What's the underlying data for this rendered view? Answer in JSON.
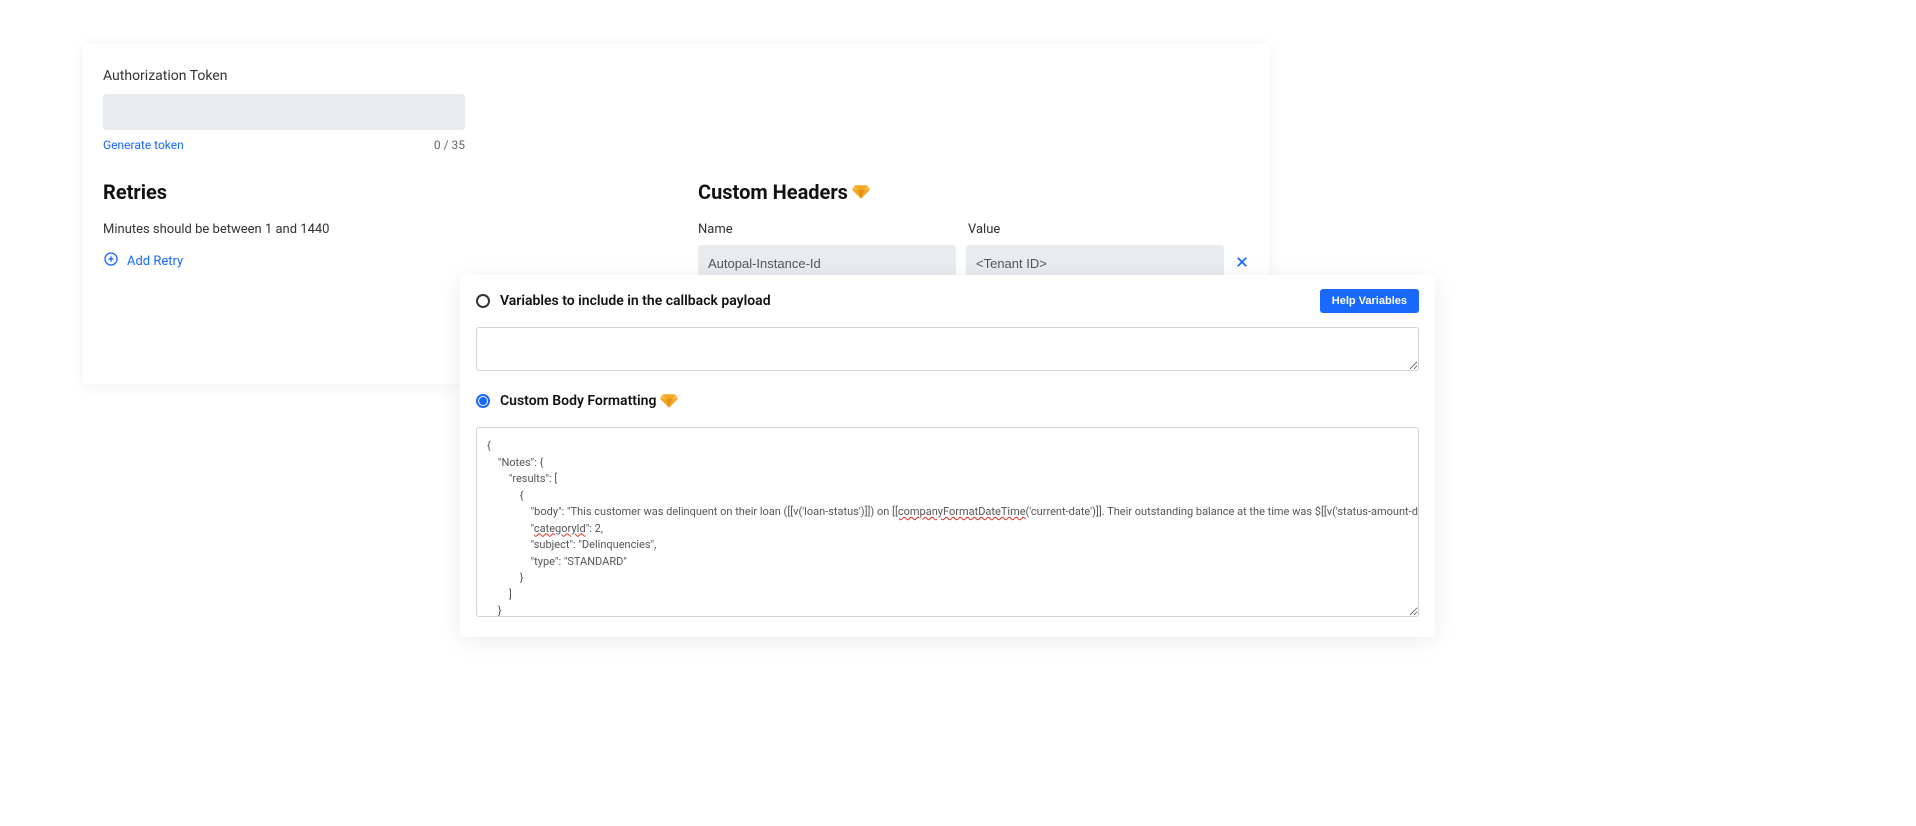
{
  "authToken": {
    "label": "Authorization Token",
    "value": "",
    "generateLinkText": "Generate token",
    "charCount": "0 / 35"
  },
  "retries": {
    "title": "Retries",
    "hint": "Minutes should be between 1 and 1440",
    "addRetryLabel": "Add Retry"
  },
  "customHeaders": {
    "title": "Custom Headers",
    "nameLabel": "Name",
    "valueLabel": "Value",
    "rows": [
      {
        "name": "Autopal-Instance-Id",
        "value": "<Tenant ID>"
      }
    ]
  },
  "variables": {
    "label": "Variables to include in the callback payload",
    "helpButtonLabel": "Help Variables",
    "value": ""
  },
  "customBody": {
    "label": "Custom Body Formatting",
    "selected": true,
    "code": {
      "line1": "{",
      "line2": "    \"Notes\": {",
      "line3": "        \"results\": [",
      "line4": "            {",
      "line5prefix": "                \"body\": \"This customer was delinquent on their loan ([[v('loan-status')]]) on ",
      "line5underline": "[[companyFormatDateTime",
      "line5suffix": "('current-date')]]. Their outstanding balance at the time was $[[v('status-amount-due')]].\",",
      "line6prefix": "                \"",
      "line6underline": "categoryId",
      "line6suffix": "\": 2,",
      "line7": "                \"subject\": \"Delinquencies\",",
      "line8": "                \"type\": \"STANDARD\"",
      "line9": "            }",
      "line10": "        ]",
      "line11": "    }",
      "line12": "}"
    }
  }
}
